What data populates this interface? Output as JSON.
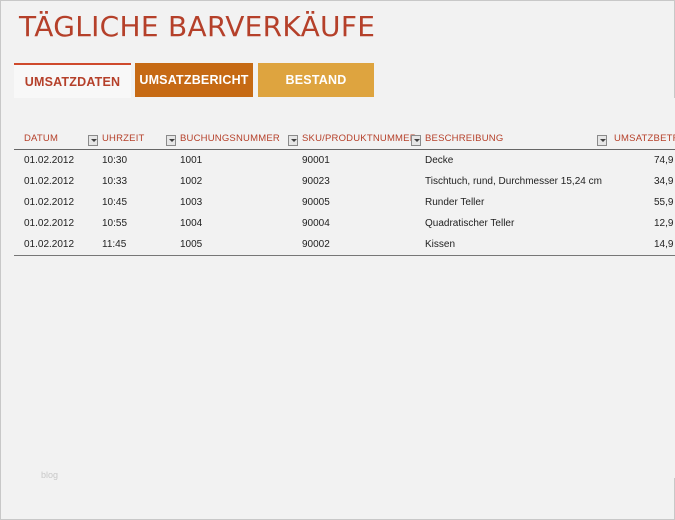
{
  "title": "TÄGLICHE BARVERKÄUFE",
  "tabs": [
    {
      "label": "UMSATZDATEN",
      "active": true
    },
    {
      "label": "UMSATZBERICHT",
      "active": false
    },
    {
      "label": "BESTAND",
      "active": false
    }
  ],
  "table": {
    "headers": [
      "DATUM",
      "UHRZEIT",
      "BUCHUNGSNUMMER",
      "SKU/PRODUKTNUMMER",
      "BESCHREIBUNG",
      "UMSATZBETR"
    ],
    "rows": [
      [
        "01.02.2012",
        "10:30",
        "1001",
        "90001",
        "Decke",
        "74,9"
      ],
      [
        "01.02.2012",
        "10:33",
        "1002",
        "90023",
        "Tischtuch, rund, Durchmesser 15,24 cm",
        "34,9"
      ],
      [
        "01.02.2012",
        "10:45",
        "1003",
        "90005",
        "Runder Teller",
        "55,9"
      ],
      [
        "01.02.2012",
        "10:55",
        "1004",
        "90004",
        "Quadratischer Teller",
        "12,9"
      ],
      [
        "01.02.2012",
        "11:45",
        "1005",
        "90002",
        "Kissen",
        "14,9"
      ]
    ]
  },
  "colors": {
    "accent": "#b5402a",
    "tab2": "#c66a14",
    "tab3": "#dea43f"
  },
  "watermark": "blog"
}
